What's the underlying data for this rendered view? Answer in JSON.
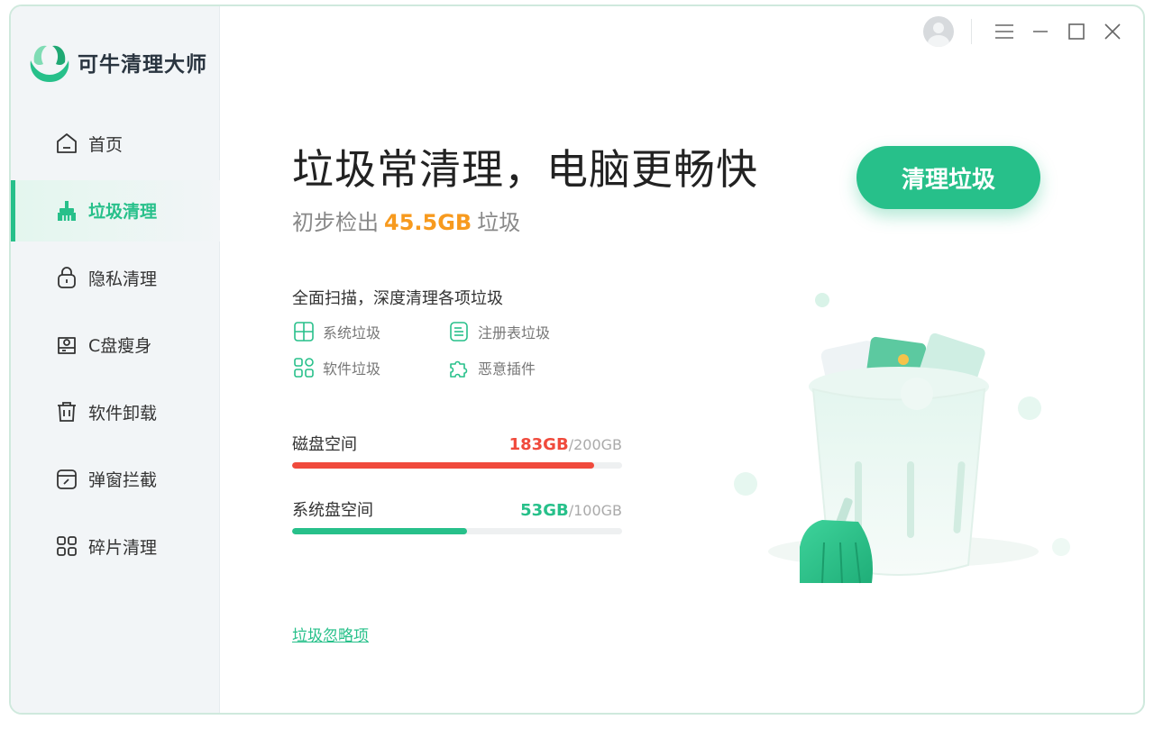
{
  "app": {
    "name": "可牛清理大师"
  },
  "sidebar": {
    "items": [
      {
        "label": "首页",
        "icon": "home-icon",
        "active": false
      },
      {
        "label": "垃圾清理",
        "icon": "broom-icon",
        "active": true
      },
      {
        "label": "隐私清理",
        "icon": "lock-icon",
        "active": false
      },
      {
        "label": "C盘瘦身",
        "icon": "disk-icon",
        "active": false
      },
      {
        "label": "软件卸载",
        "icon": "trash-icon",
        "active": false
      },
      {
        "label": "弹窗拦截",
        "icon": "popup-icon",
        "active": false
      },
      {
        "label": "碎片清理",
        "icon": "grid-icon",
        "active": false
      }
    ]
  },
  "main": {
    "title": "垃圾常清理，电脑更畅快",
    "sub_prefix": "初步检出",
    "sub_amount": "45.5GB",
    "sub_suffix": "垃圾",
    "clean_button": "清理垃圾",
    "scan_heading": "全面扫描，深度清理各项垃圾",
    "categories": [
      {
        "label": "系统垃圾",
        "icon": "windows-icon"
      },
      {
        "label": "注册表垃圾",
        "icon": "document-icon"
      },
      {
        "label": "软件垃圾",
        "icon": "apps-icon"
      },
      {
        "label": "恶意插件",
        "icon": "puzzle-icon"
      }
    ],
    "disk": {
      "label": "磁盘空间",
      "used": "183GB",
      "total": "/200GB",
      "fraction": 0.915,
      "color": "#f04a3c"
    },
    "system_disk": {
      "label": "系统盘空间",
      "used": "53GB",
      "total": "/100GB",
      "fraction": 0.53,
      "color": "#27c08a"
    },
    "ignore_link": "垃圾忽略项"
  },
  "colors": {
    "accent": "#27c08a",
    "warning": "#f79a1e",
    "danger": "#f04a3c"
  }
}
